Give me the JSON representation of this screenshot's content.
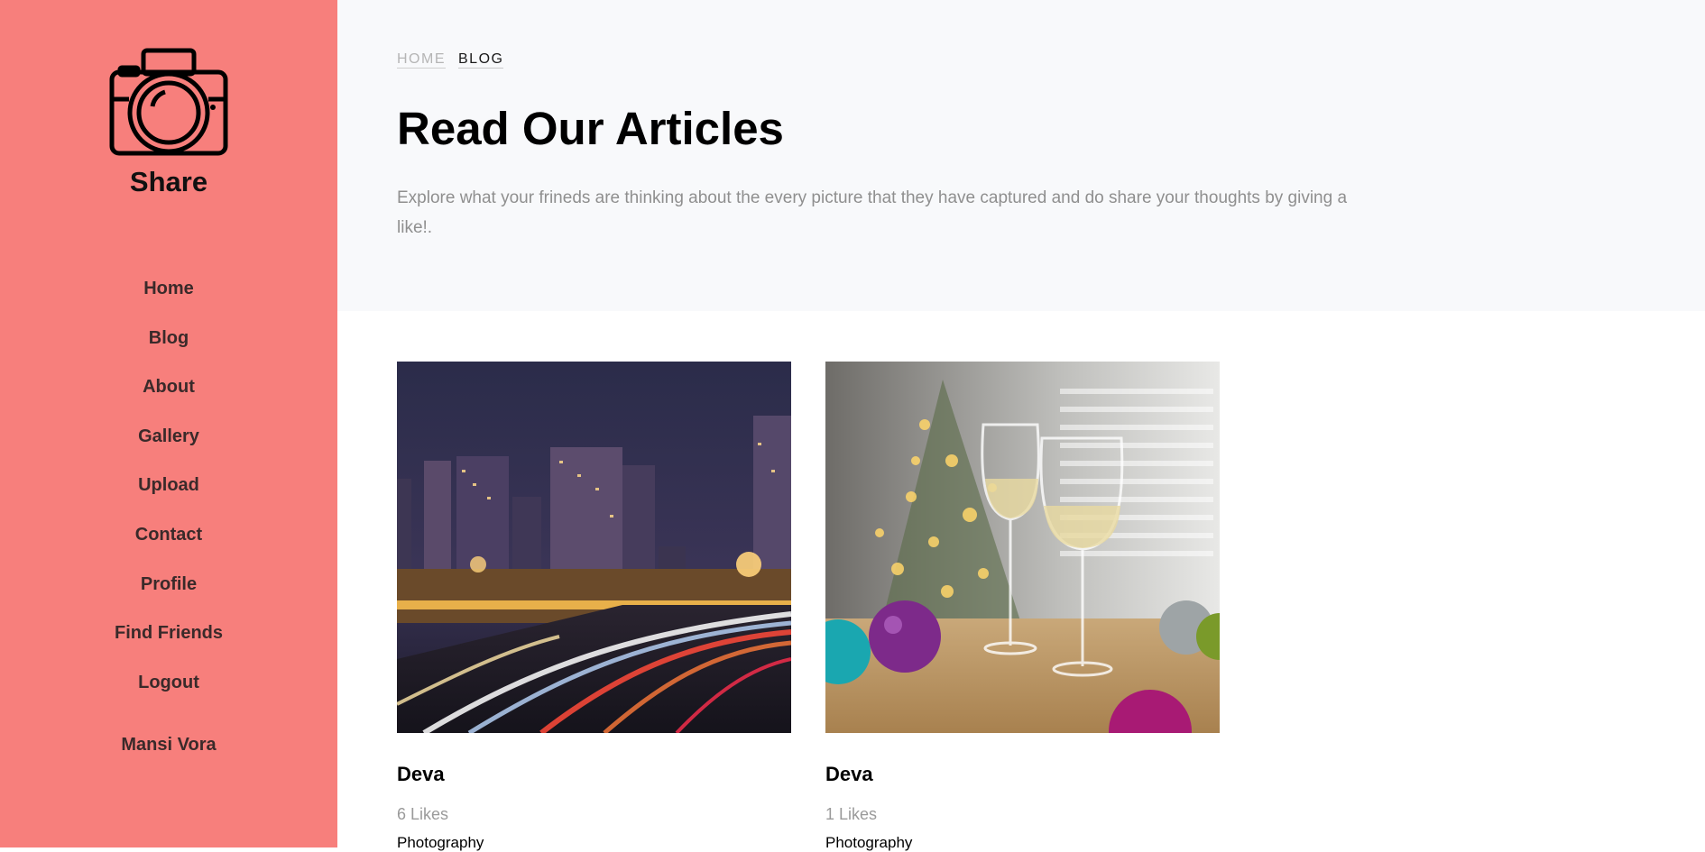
{
  "brand": {
    "name": "Share",
    "icon": "camera-icon"
  },
  "nav": {
    "items": [
      {
        "label": "Home"
      },
      {
        "label": "Blog"
      },
      {
        "label": "About"
      },
      {
        "label": "Gallery"
      },
      {
        "label": "Upload"
      },
      {
        "label": "Contact"
      },
      {
        "label": "Profile"
      },
      {
        "label": "Find Friends"
      },
      {
        "label": "Logout"
      }
    ],
    "user": "Mansi Vora"
  },
  "breadcrumb": {
    "home": "HOME",
    "current": "BLOG"
  },
  "header": {
    "title": "Read Our Articles",
    "description": "Explore what your frineds are thinking about the every picture that they have captured and do share your thoughts by giving a like!."
  },
  "posts": [
    {
      "author": "Deva",
      "likes": "6 Likes",
      "category": "Photography",
      "image": "city-night-traffic-photo"
    },
    {
      "author": "Deva",
      "likes": "1 Likes",
      "category": "Photography",
      "image": "wine-glasses-christmas-photo"
    }
  ],
  "colors": {
    "sidebar": "#f77f7c",
    "hero_bg": "#f8f9fb",
    "muted_text": "#8f8f8f"
  }
}
